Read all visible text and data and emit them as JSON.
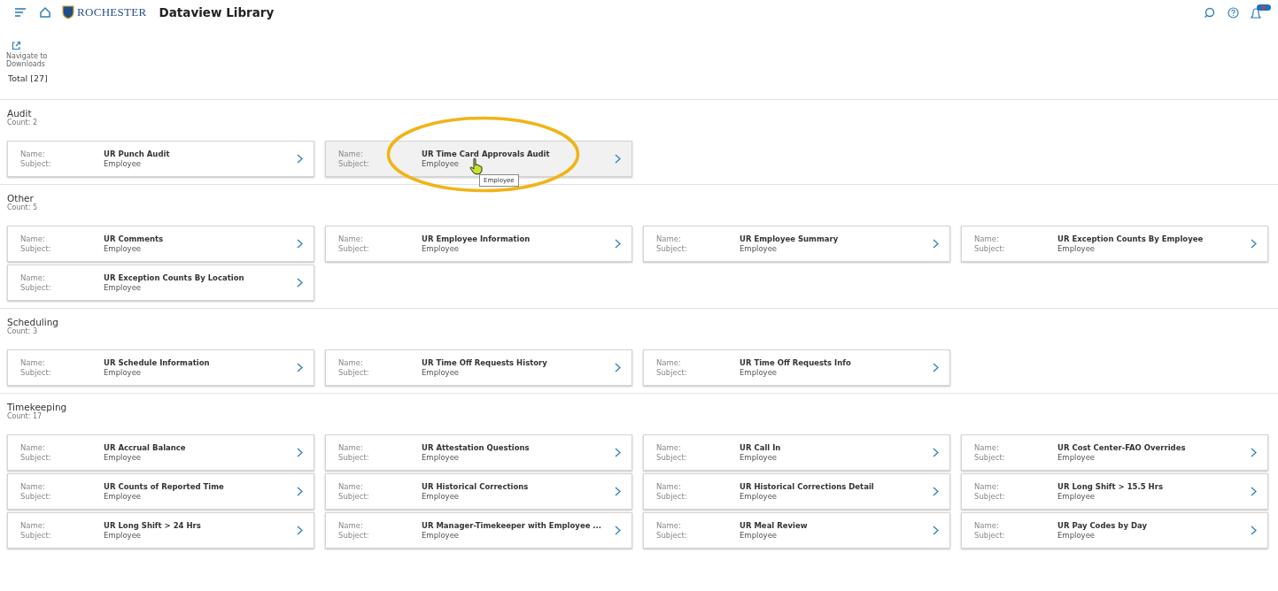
{
  "header": {
    "logo_text": "ROCHESTER",
    "title": "Dataview Library"
  },
  "toolbar": {
    "downloads_label": "Navigate to Downloads"
  },
  "total": "Total [27]",
  "sections": [
    {
      "title": "Audit",
      "count_label": "Count:",
      "count": "2",
      "cards": [
        {
          "name_label": "Name:",
          "name": "UR Punch Audit",
          "subject_label": "Subject:",
          "subject": "Employee",
          "selected": false
        },
        {
          "name_label": "Name:",
          "name": "UR Time Card Approvals Audit",
          "subject_label": "Subject:",
          "subject": "Employee",
          "selected": true,
          "circled": true,
          "tooltip": "Employee"
        }
      ]
    },
    {
      "title": "Other",
      "count_label": "Count:",
      "count": "5",
      "cards": [
        {
          "name_label": "Name:",
          "name": "UR Comments",
          "subject_label": "Subject:",
          "subject": "Employee",
          "selected": false
        },
        {
          "name_label": "Name:",
          "name": "UR Employee Information",
          "subject_label": "Subject:",
          "subject": "Employee",
          "selected": false
        },
        {
          "name_label": "Name:",
          "name": "UR Employee Summary",
          "subject_label": "Subject:",
          "subject": "Employee",
          "selected": false
        },
        {
          "name_label": "Name:",
          "name": "UR Exception Counts By Employee",
          "subject_label": "Subject:",
          "subject": "Employee",
          "selected": false
        },
        {
          "name_label": "Name:",
          "name": "UR Exception Counts By Location",
          "subject_label": "Subject:",
          "subject": "Employee",
          "selected": false
        }
      ]
    },
    {
      "title": "Scheduling",
      "count_label": "Count:",
      "count": "3",
      "cards": [
        {
          "name_label": "Name:",
          "name": "UR Schedule Information",
          "subject_label": "Subject:",
          "subject": "Employee",
          "selected": false
        },
        {
          "name_label": "Name:",
          "name": "UR Time Off Requests History",
          "subject_label": "Subject:",
          "subject": "Employee",
          "selected": false
        },
        {
          "name_label": "Name:",
          "name": "UR Time Off Requests Info",
          "subject_label": "Subject:",
          "subject": "Employee",
          "selected": false
        }
      ]
    },
    {
      "title": "Timekeeping",
      "count_label": "Count:",
      "count": "17",
      "cards": [
        {
          "name_label": "Name:",
          "name": "UR Accrual Balance",
          "subject_label": "Subject:",
          "subject": "Employee",
          "selected": false
        },
        {
          "name_label": "Name:",
          "name": "UR Attestation Questions",
          "subject_label": "Subject:",
          "subject": "Employee",
          "selected": false
        },
        {
          "name_label": "Name:",
          "name": "UR Call In",
          "subject_label": "Subject:",
          "subject": "Employee",
          "selected": false
        },
        {
          "name_label": "Name:",
          "name": "UR Cost Center-FAO Overrides",
          "subject_label": "Subject:",
          "subject": "Employee",
          "selected": false
        },
        {
          "name_label": "Name:",
          "name": "UR Counts of Reported Time",
          "subject_label": "Subject:",
          "subject": "Employee",
          "selected": false
        },
        {
          "name_label": "Name:",
          "name": "UR Historical Corrections",
          "subject_label": "Subject:",
          "subject": "Employee",
          "selected": false
        },
        {
          "name_label": "Name:",
          "name": "UR Historical Corrections Detail",
          "subject_label": "Subject:",
          "subject": "Employee",
          "selected": false
        },
        {
          "name_label": "Name:",
          "name": "UR Long Shift > 15.5 Hrs",
          "subject_label": "Subject:",
          "subject": "Employee",
          "selected": false
        },
        {
          "name_label": "Name:",
          "name": "UR Long Shift > 24 Hrs",
          "subject_label": "Subject:",
          "subject": "Employee",
          "selected": false
        },
        {
          "name_label": "Name:",
          "name": "UR Manager-Timekeeper with Employee ...",
          "subject_label": "Subject:",
          "subject": "Employee",
          "selected": false
        },
        {
          "name_label": "Name:",
          "name": "UR Meal Review",
          "subject_label": "Subject:",
          "subject": "Employee",
          "selected": false
        },
        {
          "name_label": "Name:",
          "name": "UR Pay Codes by Day",
          "subject_label": "Subject:",
          "subject": "Employee",
          "selected": false
        }
      ]
    }
  ]
}
